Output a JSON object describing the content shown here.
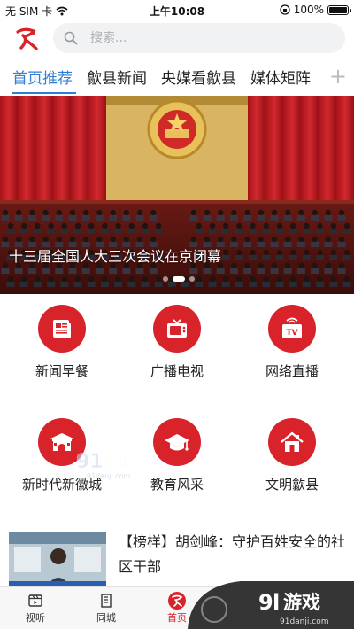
{
  "status_bar": {
    "carrier": "无 SIM 卡",
    "time": "上午10:08",
    "battery_percent": "100%",
    "battery_level": 1.0
  },
  "header": {
    "logo_icon": "red-calligraphy-logo-icon",
    "search_placeholder": "搜索..."
  },
  "tabs": [
    {
      "label": "首页推荐",
      "active": true
    },
    {
      "label": "歙县新闻",
      "active": false
    },
    {
      "label": "央媒看歙县",
      "active": false
    },
    {
      "label": "媒体矩阵",
      "active": false
    }
  ],
  "tab_add_label": "+",
  "banner": {
    "caption": "十三届全国人大三次会议在京闭幕",
    "slide_count": 3,
    "active_slide": 2
  },
  "grid": [
    {
      "label": "新闻早餐",
      "icon": "newspaper-icon"
    },
    {
      "label": "广播电视",
      "icon": "tv-icon"
    },
    {
      "label": "网络直播",
      "icon": "live-tv-icon"
    },
    {
      "label": "新时代新徽城",
      "icon": "city-gate-icon"
    },
    {
      "label": "教育风采",
      "icon": "graduation-cap-icon"
    },
    {
      "label": "文明歙县",
      "icon": "house-icon"
    }
  ],
  "news": {
    "title": "【榜样】胡剑峰：守护百姓安全的社区干部"
  },
  "bottom_nav": [
    {
      "label": "视听",
      "icon": "video-icon",
      "active": false
    },
    {
      "label": "同城",
      "icon": "building-icon",
      "active": false
    },
    {
      "label": "首页",
      "icon": "home-logo-icon",
      "active": true
    }
  ],
  "watermark": {
    "brand": "91游戏",
    "url": "91danji.com"
  },
  "colors": {
    "accent_blue": "#2f7fd6",
    "brand_red": "#d8232a"
  }
}
